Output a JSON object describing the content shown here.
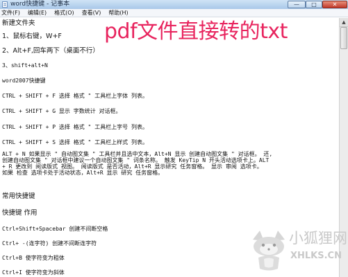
{
  "window": {
    "title": "word快捷键 - 记事本",
    "controls": {
      "minimize": "—",
      "maximize": "□",
      "close": "✕"
    }
  },
  "menu": [
    "文件(F)",
    "编辑(E)",
    "格式(O)",
    "查看(V)",
    "帮助(H)"
  ],
  "document": {
    "lines": [
      "新建文件夹",
      "1、鼠标右键，W+F",
      "2、Alt+F,回车两下（桌面不行）",
      "3、shift+alt+N",
      "word2007快捷键",
      "CTRL + SHIFT + F 选择 格式 \" 工具栏上字体 列表。",
      "CTRL + SHIFT + G 显示 字数统计 对话框。",
      "CTRL + SHIFT + P 选择 格式 \" 工具栏上字号 列表。",
      "CTRL + SHIFT + S 选择 格式 \" 工具栏上样式 列表。",
      "ALT + N 如果显示 \" 自动图文集 \" 工具栏并且选中文本，Alt+N 显示 创建自动图文集 \" 对话框。 还,",
      "创建自动图文集 \" 对话框中建议一个自动图文集 \" 词条名称。 触发 KeyTip N 开头活动选项卡上。ALT",
      "+ R 更改到 阅读版式 视图。 阅读版式 是否活动，Alt+R 显示研究 任务窗格。 显示 审阅 选项卡。",
      "如果 检查 选项卡处于活动状态，Alt+R 显示 研究 任务窗格。",
      "常用快捷键",
      "快捷键      作用",
      "Ctrl+Shift+Spacebar      创建不间断空格",
      "Ctrl+ -(连字符)      创建不间断连字符",
      "Ctrl+B      使字符变为粗体",
      "Ctrl+I      使字符变为斜体"
    ]
  },
  "overlay_title": "pdf文件直接转的txt",
  "watermark": {
    "cn": "小狐狸网",
    "en": "XHLKS.CN"
  },
  "colors": {
    "overlay": "#e8245e",
    "watermark": "#c9c9c9",
    "titlebar": "#b9d3ee"
  }
}
